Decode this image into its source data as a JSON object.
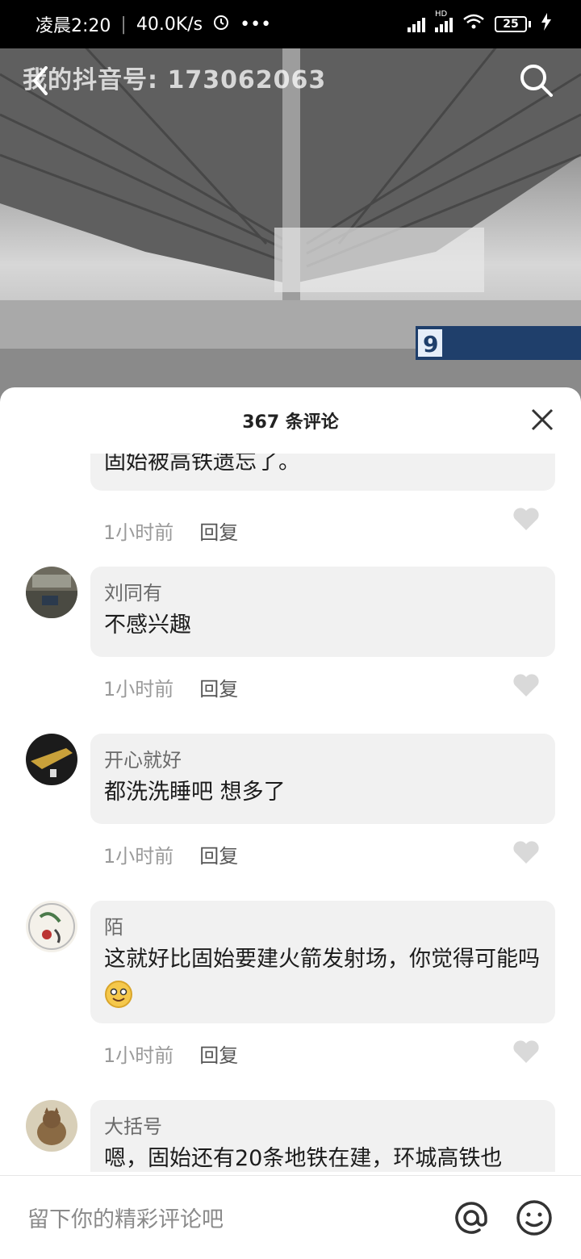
{
  "status_bar": {
    "time": "凌晨2:20",
    "speed": "40.0K/s",
    "more": "•••",
    "hd_label": "HD",
    "battery": "25"
  },
  "video": {
    "douyin_id": "我的抖音号: 173062063"
  },
  "comments_panel": {
    "title": "367 条评论"
  },
  "comments": [
    {
      "username": "",
      "text": "固始被高铁遗忘了。",
      "time": "1小时前",
      "reply": "回复"
    },
    {
      "username": "刘同有",
      "text": "不感兴趣",
      "time": "1小时前",
      "reply": "回复"
    },
    {
      "username": "开心就好",
      "text": "都洗洗睡吧 想多了",
      "time": "1小时前",
      "reply": "回复"
    },
    {
      "username": "陌",
      "text": "这就好比固始要建火箭发射场，你觉得可能吗",
      "time": "1小时前",
      "reply": "回复"
    },
    {
      "username": "大括号",
      "text": "嗯，固始还有20条地铁在建，环城高铁也",
      "time": "",
      "reply": ""
    }
  ],
  "input": {
    "placeholder": "留下你的精彩评论吧"
  },
  "icons": {
    "back": "chevron-left-icon",
    "search": "search-icon",
    "close": "close-icon",
    "like": "heart-icon",
    "at": "at-sign-icon",
    "emoji": "smiley-icon"
  },
  "colors": {
    "sheet_bg": "#ffffff",
    "bubble_bg": "#f1f1f1",
    "heart": "#d9d9d9",
    "platform_sign": "#1f3f6b"
  }
}
